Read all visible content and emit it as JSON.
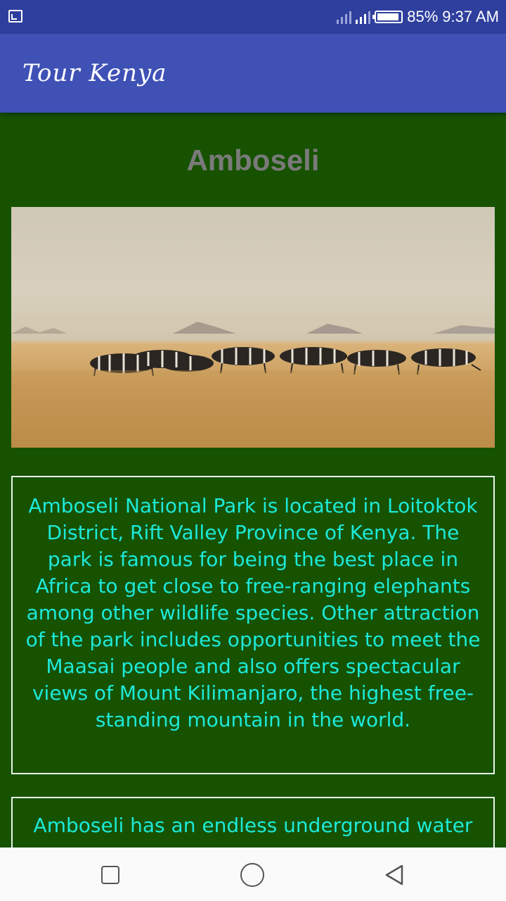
{
  "status_bar": {
    "battery": "85%",
    "time": "9:37 AM",
    "icons": [
      "screen-cast-icon",
      "signal-icon",
      "signal-icon",
      "battery-icon"
    ]
  },
  "app_bar": {
    "title": "Tour Kenya"
  },
  "park": {
    "name": "Amboseli",
    "description_1": "Amboseli National Park is located in Loitoktok District, Rift Valley Province of Kenya. The park is famous for being the best place in Africa to get close to free-ranging elephants among other wildlife species. Other attraction of the park includes opportunities to meet the Maasai people and also offers spectacular views of Mount Kilimanjaro, the highest free-standing mountain in the world.",
    "description_2": "Amboseli has an endless underground water"
  },
  "nav_bar": {
    "icons": [
      "recents-icon",
      "home-icon",
      "back-icon"
    ]
  },
  "colors": {
    "status_bar": "#2f3f9e",
    "app_bar": "#3f51b5",
    "background": "#165200",
    "text_accent": "#1de9d9",
    "title": "#7a7a7a"
  }
}
